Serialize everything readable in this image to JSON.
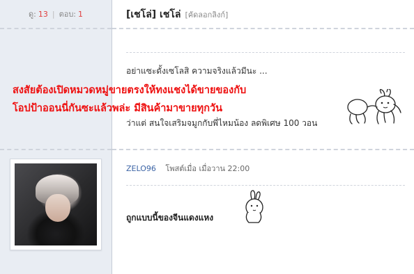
{
  "stats": {
    "views_label": "ดู:",
    "views": "13",
    "replies_label": "ตอบ:",
    "replies": "1"
  },
  "post": {
    "title": "[เชโล่] เชโล่",
    "copy_link": "[คัดลอกลิงก์]",
    "line1": "อย่าแซะดั้งเซโลสิ ความจริงแล้วมีนะ ...",
    "line2": "ว่าแต่ สนใจเสริมจมูกกับพี่ไหมน้อง ลดพิเศษ 100 วอน"
  },
  "overlay": {
    "line1": "สงสัยต้องเปิดหมวดหมู่ขายตรงให้ทงแชงได้ขายของกับ",
    "line2": "โอปป้าออนนี่กันซะแล้วพล่ะ มีสินค้ามาขายทุกวัน"
  },
  "reply": {
    "author": "ZELO96",
    "posted_label": "โพสต์เมื่อ",
    "time": "เมื่อวาน 22:00",
    "text": "ถูกแบบนี้ของจีนแดงแหง"
  },
  "colors": {
    "sidebar_bg": "#e9edf3",
    "overlay_red": "#ee1111",
    "author_blue": "#3b63a5",
    "count_red": "#e04040"
  },
  "icons": {
    "sticker_1": "rabbit-hug-sticker-icon",
    "sticker_2": "rabbit-sticker-icon"
  }
}
